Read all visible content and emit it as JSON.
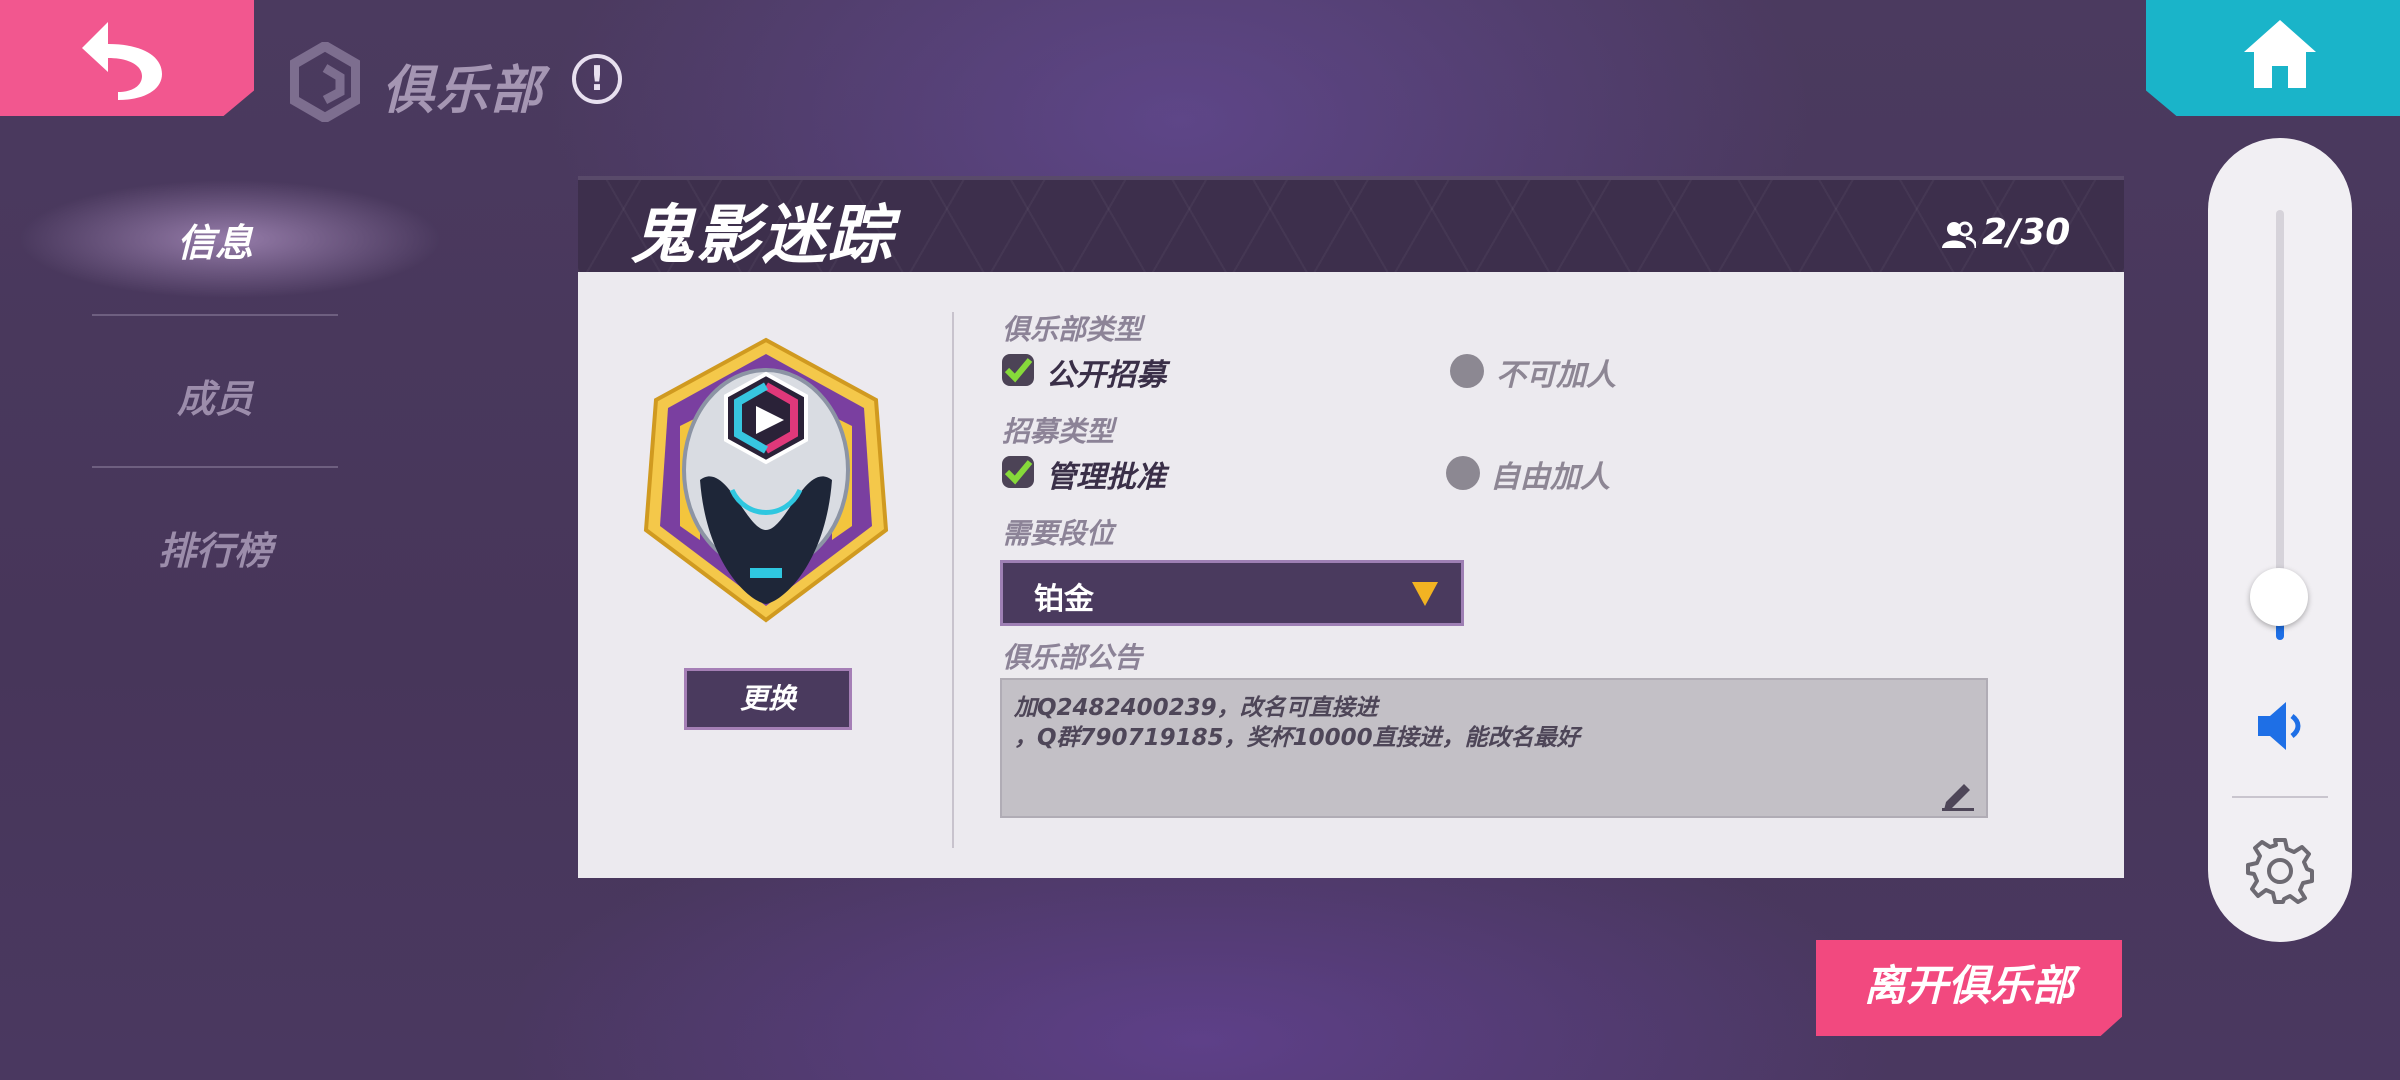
{
  "header": {
    "title": "俱乐部",
    "info_mark": "!"
  },
  "sidebar": {
    "items": [
      {
        "label": "信息",
        "active": true
      },
      {
        "label": "成员",
        "active": false
      },
      {
        "label": "排行榜",
        "active": false
      }
    ]
  },
  "club": {
    "name": "鬼影迷踪",
    "member_count": "2/30",
    "change_button": "更换",
    "club_type_label": "俱乐部类型",
    "club_type_options": [
      {
        "label": "公开招募",
        "selected": true
      },
      {
        "label": "不可加人",
        "selected": false
      }
    ],
    "recruit_type_label": "招募类型",
    "recruit_type_options": [
      {
        "label": "管理批准",
        "selected": true
      },
      {
        "label": "自由加人",
        "selected": false
      }
    ],
    "rank_label": "需要段位",
    "rank_value": "铂金",
    "notice_label": "俱乐部公告",
    "notice_lines": [
      "加Q2482400239，改名可直接进",
      "，Q群790719185，奖杯10000直接进，能改名最好"
    ]
  },
  "leave_button": "离开俱乐部",
  "volume": {
    "level": 0.1
  },
  "colors": {
    "back": "#f2578f",
    "home": "#1ab4c9",
    "leave": "#f2497f",
    "accent_check": "#7fcf3a",
    "rank_arrow": "#f2b322",
    "volume_fill": "#1e6fe6"
  },
  "icons": [
    "back-arrow-icon",
    "club-logo-icon",
    "info-icon",
    "home-icon",
    "members-icon",
    "check-icon",
    "edit-pencil-icon",
    "speaker-icon",
    "gear-icon"
  ]
}
